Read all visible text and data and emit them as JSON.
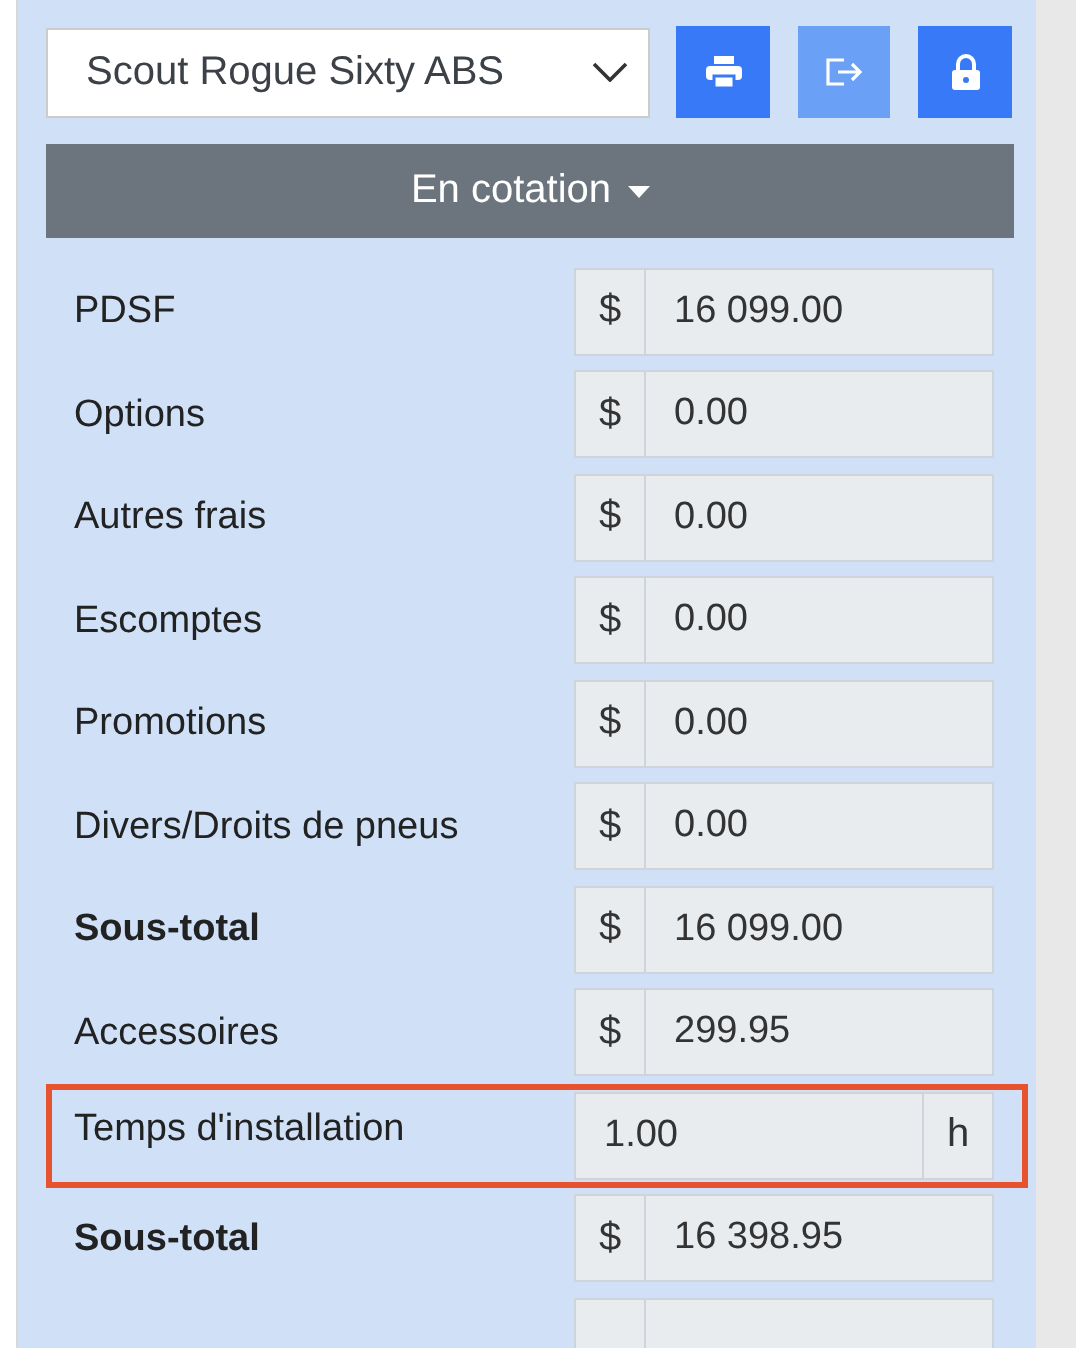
{
  "model_select": {
    "value": "Scout Rogue Sixty ABS"
  },
  "toolbar": [
    {
      "kind": "print",
      "disabled": false
    },
    {
      "kind": "export",
      "disabled": true
    },
    {
      "kind": "lock",
      "disabled": false
    }
  ],
  "status_button": {
    "label": "En cotation"
  },
  "rows": [
    {
      "label": "PDSF",
      "kind": "currency",
      "addon": "$",
      "value": "16 099.00",
      "bold": false,
      "highlighted": false
    },
    {
      "label": "Options",
      "kind": "currency",
      "addon": "$",
      "value": "0.00",
      "bold": false,
      "highlighted": false
    },
    {
      "label": "Autres frais",
      "kind": "currency",
      "addon": "$",
      "value": "0.00",
      "bold": false,
      "highlighted": false
    },
    {
      "label": "Escomptes",
      "kind": "currency",
      "addon": "$",
      "value": "0.00",
      "bold": false,
      "highlighted": false
    },
    {
      "label": "Promotions",
      "kind": "currency",
      "addon": "$",
      "value": "0.00",
      "bold": false,
      "highlighted": false
    },
    {
      "label": "Divers/Droits de pneus",
      "kind": "currency",
      "addon": "$",
      "value": "0.00",
      "bold": false,
      "highlighted": false
    },
    {
      "label": "Sous-total",
      "kind": "currency",
      "addon": "$",
      "value": "16 099.00",
      "bold": true,
      "highlighted": false
    },
    {
      "label": "Accessoires",
      "kind": "currency",
      "addon": "$",
      "value": "299.95",
      "bold": false,
      "highlighted": false
    },
    {
      "label": "Temps d'installation",
      "kind": "hours",
      "addon": "h",
      "value": "1.00",
      "bold": false,
      "highlighted": true
    },
    {
      "label": "Sous-total",
      "kind": "currency",
      "addon": "$",
      "value": "16 398.95",
      "bold": true,
      "highlighted": false
    }
  ]
}
